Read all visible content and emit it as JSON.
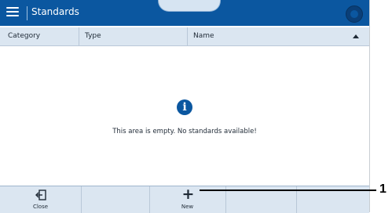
{
  "header": {
    "title": "Standards"
  },
  "table": {
    "columns": [
      "Category",
      "Type",
      "Name"
    ],
    "sort": "ascending"
  },
  "empty_state": {
    "icon": "info-icon",
    "message": "This area is empty. No standards available!"
  },
  "bottom_bar": {
    "buttons": [
      {
        "label": "Close",
        "icon": "exit-icon"
      },
      {
        "label": "New",
        "icon": "plus-icon"
      }
    ]
  },
  "callout": {
    "number": "1"
  },
  "colors": {
    "primary": "#0b57a0",
    "header_bg": "#dbe6f1"
  }
}
